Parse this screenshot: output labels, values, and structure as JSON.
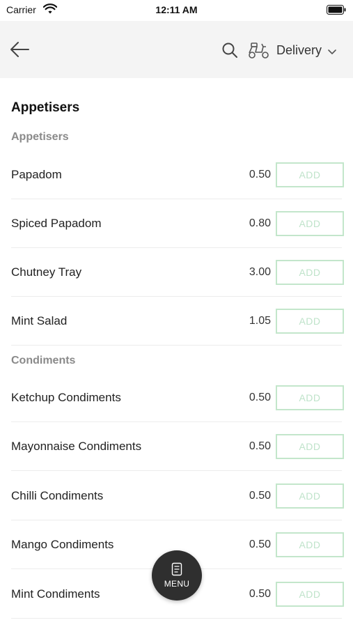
{
  "status_bar": {
    "carrier": "Carrier",
    "time": "12:11 AM",
    "icons": [
      "wifi-icon",
      "battery-icon"
    ]
  },
  "nav": {
    "back_icon": "back-arrow-icon",
    "search_icon": "search-icon",
    "delivery_icon": "scooter-icon",
    "delivery_label": "Delivery",
    "dropdown_icon": "chevron-down-icon"
  },
  "page_title": "Appetisers",
  "sections": [
    {
      "heading": "Appetisers",
      "items": [
        {
          "name": "Papadom",
          "price": "0.50",
          "button": "ADD"
        },
        {
          "name": "Spiced Papadom",
          "price": "0.80",
          "button": "ADD"
        },
        {
          "name": "Chutney Tray",
          "price": "3.00",
          "button": "ADD"
        },
        {
          "name": "Mint Salad",
          "price": "1.05",
          "button": "ADD"
        }
      ]
    },
    {
      "heading": "Condiments",
      "items": [
        {
          "name": "Ketchup Condiments",
          "price": "0.50",
          "button": "ADD"
        },
        {
          "name": "Mayonnaise Condiments",
          "price": "0.50",
          "button": "ADD"
        },
        {
          "name": "Chilli Condiments",
          "price": "0.50",
          "button": "ADD"
        },
        {
          "name": "Mango Condiments",
          "price": "0.50",
          "button": "ADD"
        },
        {
          "name": "Mint Condiments",
          "price": "0.50",
          "button": "ADD"
        }
      ]
    }
  ],
  "fab": {
    "label": "MENU",
    "icon": "menu-card-icon"
  },
  "colors": {
    "nav_background": "#f4f4f4",
    "add_button_border": "#c3e6cb",
    "add_button_text": "#bfe3ca",
    "section_heading": "#8a8a8a",
    "fab_background": "#2f2f2f"
  }
}
